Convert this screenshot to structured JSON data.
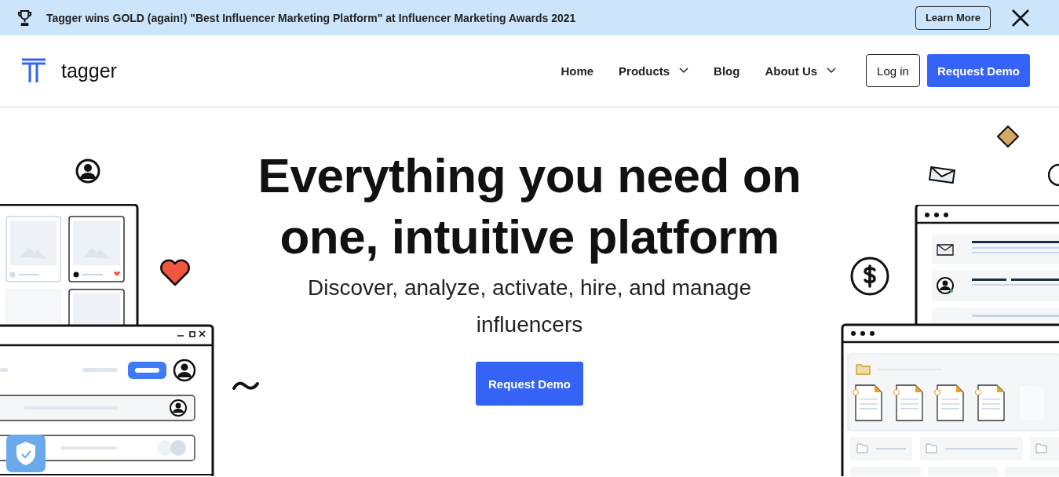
{
  "banner": {
    "text": "Tagger wins GOLD (again!) \"Best Influencer Marketing Platform\" at Influencer Marketing Awards 2021",
    "button": "Learn More"
  },
  "nav": {
    "logo": "tagger",
    "links": [
      {
        "label": "Home",
        "kind": "link"
      },
      {
        "label": "Products",
        "kind": "dropdown"
      },
      {
        "label": "Blog",
        "kind": "link"
      },
      {
        "label": "About Us",
        "kind": "dropdown"
      }
    ],
    "login": "Log in",
    "demo": "Request Demo"
  },
  "hero": {
    "title_lines": [
      "Everything you need on",
      "one, intuitive platform"
    ],
    "subtitle": "Discover, analyze, activate, hire, and manage influencers",
    "cta": "Request Demo"
  }
}
